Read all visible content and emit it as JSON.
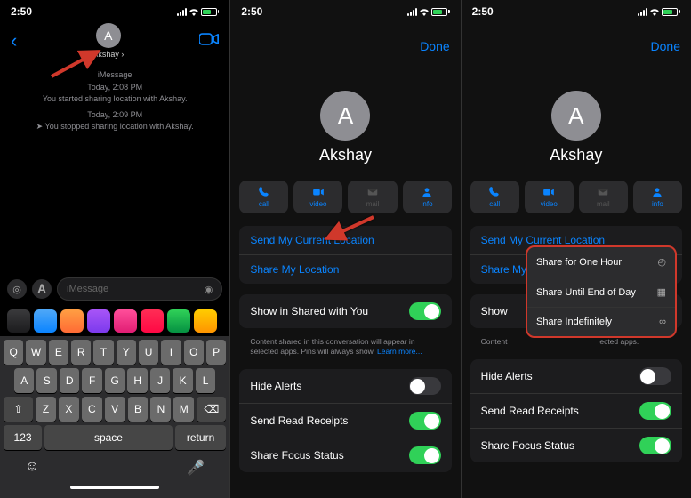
{
  "status": {
    "time": "2:50"
  },
  "nav": {
    "done": "Done"
  },
  "contact": {
    "initial": "A",
    "name": "Akshay"
  },
  "thread": {
    "header": "iMessage",
    "ts1": "Today, 2:08 PM",
    "line1": "You started sharing location with Akshay.",
    "ts2": "Today, 2:09 PM",
    "line2": "You stopped sharing location with Akshay."
  },
  "composer": {
    "placeholder": "iMessage"
  },
  "keyboard": {
    "r1": [
      "Q",
      "W",
      "E",
      "R",
      "T",
      "Y",
      "U",
      "I",
      "O",
      "P"
    ],
    "r2": [
      "A",
      "S",
      "D",
      "F",
      "G",
      "H",
      "J",
      "K",
      "L"
    ],
    "r3": [
      "Z",
      "X",
      "C",
      "V",
      "B",
      "N",
      "M"
    ],
    "num": "123",
    "space": "space",
    "return": "return"
  },
  "actions": {
    "call": "call",
    "video": "video",
    "mail": "mail",
    "info": "info"
  },
  "links": {
    "sendloc": "Send My Current Location",
    "shareloc": "Share My Location"
  },
  "settings": {
    "showShared": "Show in Shared with You",
    "hint": "Content shared in this conversation will appear in selected apps. Pins will always show. ",
    "learn": "Learn more...",
    "hideAlerts": "Hide Alerts",
    "readReceipts": "Send Read Receipts",
    "focus": "Share Focus Status"
  },
  "menu": {
    "hour": "Share for One Hour",
    "day": "Share Until End of Day",
    "indef": "Share Indefinitely"
  }
}
